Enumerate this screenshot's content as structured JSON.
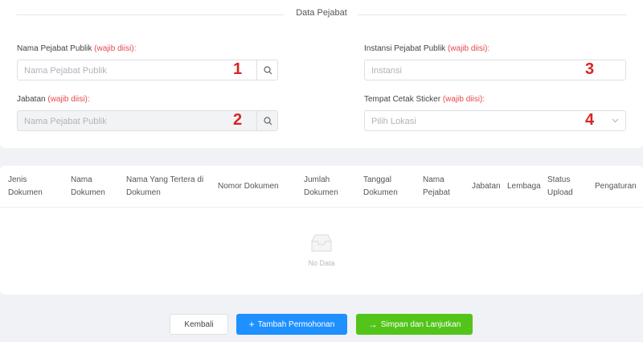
{
  "section": {
    "title": "Data Pejabat"
  },
  "form": {
    "nama": {
      "label": "Nama Pejabat Publik",
      "required": "(wajib diisi):",
      "placeholder": "Nama Pejabat Publik",
      "marker": "1"
    },
    "jabatan": {
      "label": "Jabatan",
      "required": "(wajib diisi):",
      "placeholder": "Nama Pejabat Publik",
      "marker": "2"
    },
    "instansi": {
      "label": "Instansi Pejabat Publik",
      "required": "(wajib diisi):",
      "placeholder": "Instansi",
      "marker": "3"
    },
    "lokasi": {
      "label": "Tempat Cetak Sticker",
      "required": "(wajib diisi):",
      "placeholder": "Pilih Lokasi",
      "marker": "4"
    }
  },
  "table": {
    "columns": [
      [
        "Jenis",
        "Dokumen"
      ],
      [
        "Nama",
        "Dokumen"
      ],
      [
        "Nama Yang Tertera di",
        "Dokumen"
      ],
      [
        "Nomor Dokumen"
      ],
      [
        "Jumlah",
        "Dokumen"
      ],
      [
        "Tanggal",
        "Dokumen"
      ],
      [
        "Nama",
        "Pejabat"
      ],
      [
        "Jabatan"
      ],
      [
        "Lembaga"
      ],
      [
        "Status",
        "Upload"
      ],
      [
        "Pengaturan"
      ]
    ],
    "empty_text": "No Data"
  },
  "buttons": {
    "back": "Kembali",
    "add": "Tambah Permohonan",
    "save": "Simpan dan Lanjutkan"
  },
  "colors": {
    "required": "#e5484d",
    "marker": "#d62525",
    "primary": "#1e90ff",
    "success": "#52c41a"
  }
}
